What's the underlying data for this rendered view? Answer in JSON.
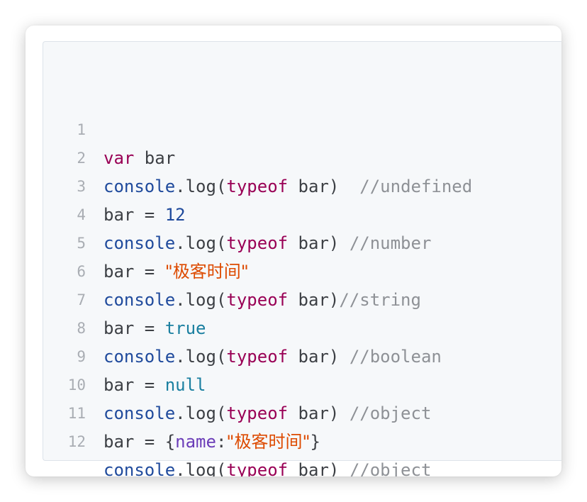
{
  "colors": {
    "keyword": "#990055",
    "builtin": "#1f4a9c",
    "number": "#1f4a9c",
    "string": "#dd4a00",
    "literal": "#1a7fa0",
    "comment": "#8e9196",
    "property": "#6b3db8",
    "plain": "#3c3f44",
    "line_number": "#a9adb3"
  },
  "lines": [
    {
      "number": "1",
      "tokens": [
        {
          "type": "keyword",
          "text": "var"
        },
        {
          "type": "plain",
          "text": " bar"
        }
      ]
    },
    {
      "number": "2",
      "tokens": [
        {
          "type": "builtin",
          "text": "console"
        },
        {
          "type": "plain",
          "text": ".log("
        },
        {
          "type": "keyword",
          "text": "typeof"
        },
        {
          "type": "plain",
          "text": " bar)  "
        },
        {
          "type": "comment",
          "text": "//undefined"
        }
      ]
    },
    {
      "number": "3",
      "tokens": [
        {
          "type": "plain",
          "text": "bar = "
        },
        {
          "type": "number",
          "text": "12"
        }
      ]
    },
    {
      "number": "4",
      "tokens": [
        {
          "type": "builtin",
          "text": "console"
        },
        {
          "type": "plain",
          "text": ".log("
        },
        {
          "type": "keyword",
          "text": "typeof"
        },
        {
          "type": "plain",
          "text": " bar) "
        },
        {
          "type": "comment",
          "text": "//number"
        }
      ]
    },
    {
      "number": "5",
      "tokens": [
        {
          "type": "plain",
          "text": "bar = "
        },
        {
          "type": "string",
          "text": "\"极客时间\""
        }
      ]
    },
    {
      "number": "6",
      "tokens": [
        {
          "type": "builtin",
          "text": "console"
        },
        {
          "type": "plain",
          "text": ".log("
        },
        {
          "type": "keyword",
          "text": "typeof"
        },
        {
          "type": "plain",
          "text": " bar)"
        },
        {
          "type": "comment",
          "text": "//string"
        }
      ]
    },
    {
      "number": "7",
      "tokens": [
        {
          "type": "plain",
          "text": "bar = "
        },
        {
          "type": "literal",
          "text": "true"
        }
      ]
    },
    {
      "number": "8",
      "tokens": [
        {
          "type": "builtin",
          "text": "console"
        },
        {
          "type": "plain",
          "text": ".log("
        },
        {
          "type": "keyword",
          "text": "typeof"
        },
        {
          "type": "plain",
          "text": " bar) "
        },
        {
          "type": "comment",
          "text": "//boolean"
        }
      ]
    },
    {
      "number": "9",
      "tokens": [
        {
          "type": "plain",
          "text": "bar = "
        },
        {
          "type": "literal",
          "text": "null"
        }
      ]
    },
    {
      "number": "10",
      "tokens": [
        {
          "type": "builtin",
          "text": "console"
        },
        {
          "type": "plain",
          "text": ".log("
        },
        {
          "type": "keyword",
          "text": "typeof"
        },
        {
          "type": "plain",
          "text": " bar) "
        },
        {
          "type": "comment",
          "text": "//object"
        }
      ]
    },
    {
      "number": "11",
      "tokens": [
        {
          "type": "plain",
          "text": "bar = {"
        },
        {
          "type": "property",
          "text": "name"
        },
        {
          "type": "plain",
          "text": ":"
        },
        {
          "type": "string",
          "text": "\"极客时间\""
        },
        {
          "type": "plain",
          "text": "}"
        }
      ]
    },
    {
      "number": "12",
      "tokens": [
        {
          "type": "builtin",
          "text": "console"
        },
        {
          "type": "plain",
          "text": ".log("
        },
        {
          "type": "keyword",
          "text": "typeof"
        },
        {
          "type": "plain",
          "text": " bar) "
        },
        {
          "type": "comment",
          "text": "//object"
        }
      ]
    }
  ]
}
